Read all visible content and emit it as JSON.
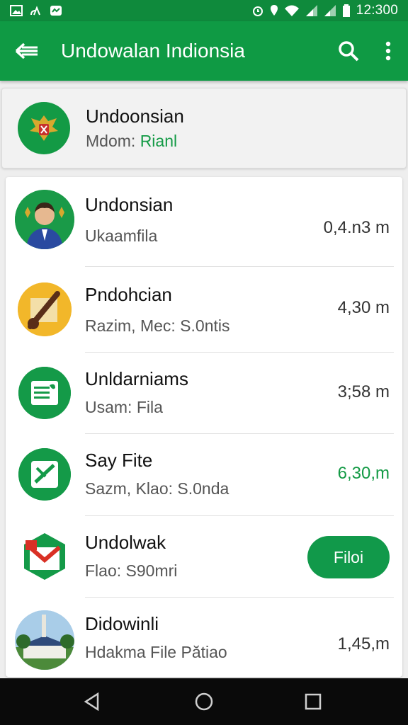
{
  "status_bar": {
    "time": "12:300",
    "icons": [
      "image-icon",
      "cast-icon",
      "message-icon",
      "alarm-icon",
      "location-icon",
      "wifi-icon",
      "signal-icon",
      "signal-icon",
      "battery-icon"
    ]
  },
  "app_bar": {
    "title": "Undowalan Indionsia",
    "back_icon": "arrow-left-icon",
    "actions": [
      "search-icon",
      "more-vert-icon"
    ]
  },
  "profile": {
    "title": "Undoonsian",
    "sub_prefix": "Mdom: ",
    "sub_value": "Rianl",
    "icon": "garuda-emblem-icon"
  },
  "list": {
    "items": [
      {
        "title": "Undonsian",
        "subtitle": "Ukaamfila",
        "meta": "0,4.n3 m",
        "avatar": "official-avatar-icon"
      },
      {
        "title": "Pndohcian",
        "subtitle": "Razim, Mec: S.0ntis",
        "meta": "4,30 m",
        "avatar": "instrument-avatar-icon"
      },
      {
        "title": "Unldarniams",
        "subtitle": "Usam: Fila",
        "meta": "3;58 m",
        "avatar": "document-icon"
      },
      {
        "title": "Say Fite",
        "subtitle": "Sazm, Klao: S.0nda",
        "meta": "6,30,m",
        "avatar": "file-edit-icon"
      },
      {
        "title": "Undolwak",
        "subtitle": "Flao: S90mri",
        "button": "Filoi",
        "avatar": "gmail-icon"
      },
      {
        "title": "Didowinli",
        "subtitle": "Hdakma File Pătiao",
        "meta": "1,45,m",
        "avatar": "building-photo-icon"
      }
    ]
  },
  "nav_bar": {
    "icons": [
      "back-triangle-icon",
      "home-circle-icon",
      "recents-square-icon"
    ]
  },
  "colors": {
    "primary": "#0f9a44",
    "status": "#0f8a3c",
    "accent": "#139a45",
    "background": "#eeeeee"
  }
}
